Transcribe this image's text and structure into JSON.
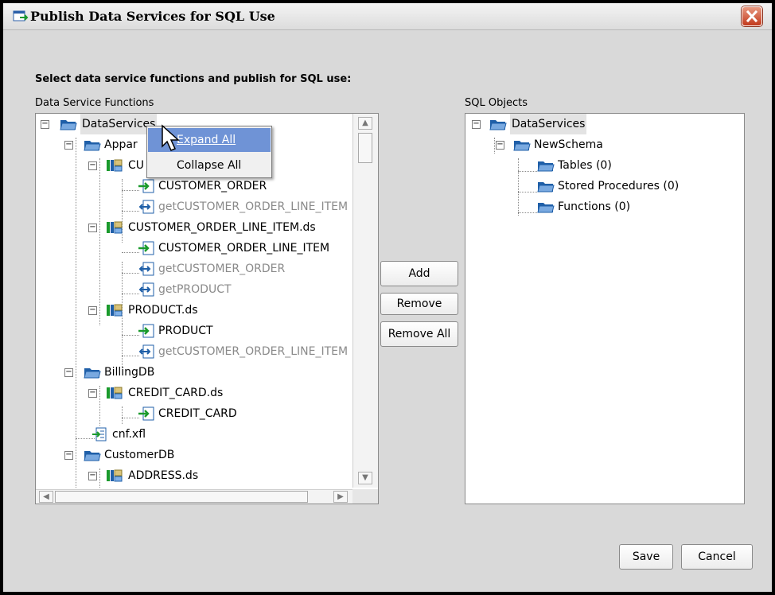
{
  "window": {
    "title": "Publish Data Services for SQL Use",
    "heading": "Select data service functions and publish for SQL use:"
  },
  "left_panel": {
    "label": "Data Service Functions",
    "nodes": [
      "DataServices",
      "Appar",
      "CU",
      "CUSTOMER_ORDER",
      "getCUSTOMER_ORDER_LINE_ITEM",
      "CUSTOMER_ORDER_LINE_ITEM.ds",
      "CUSTOMER_ORDER_LINE_ITEM",
      "getCUSTOMER_ORDER",
      "getPRODUCT",
      "PRODUCT.ds",
      "PRODUCT",
      "getCUSTOMER_ORDER_LINE_ITEM",
      "BillingDB",
      "CREDIT_CARD.ds",
      "CREDIT_CARD",
      "cnf.xfl",
      "CustomerDB",
      "ADDRESS.ds"
    ]
  },
  "right_panel": {
    "label": "SQL Objects",
    "nodes": [
      "DataServices",
      "NewSchema",
      "Tables (0)",
      "Stored Procedures (0)",
      "Functions (0)"
    ]
  },
  "buttons": {
    "add": "Add",
    "remove": "Remove",
    "remove_all": "Remove All",
    "save": "Save",
    "cancel": "Cancel"
  },
  "context_menu": {
    "expand_all": "Expand All",
    "collapse_all": "Collapse All"
  },
  "colors": {
    "folder": "#1f5fa8",
    "arrow_green": "#1a9a2c",
    "menu_highlight": "#6f93d6",
    "close_red": "#c2391c"
  }
}
